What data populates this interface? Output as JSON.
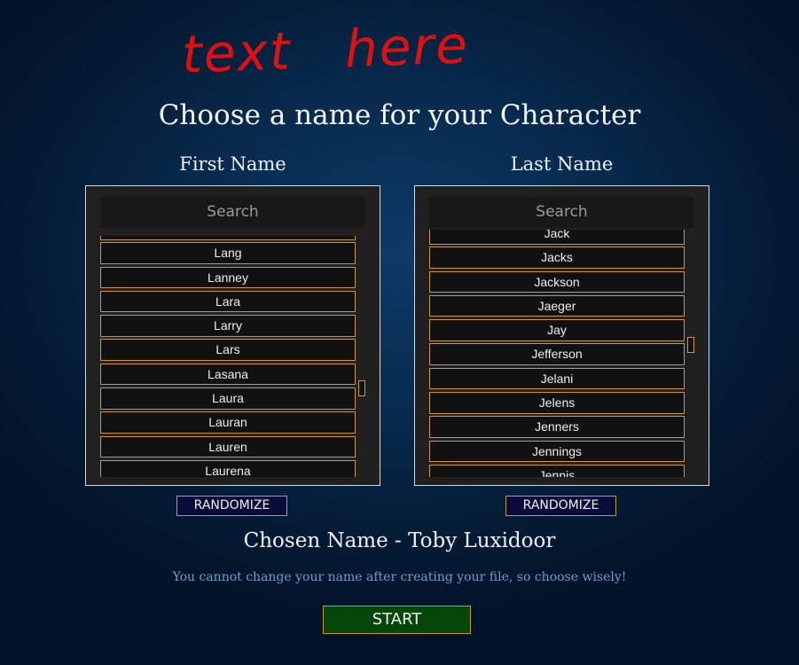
{
  "annotation": "text here",
  "title": "Choose a name for your Character",
  "first": {
    "heading": "First Name",
    "search_placeholder": "Search",
    "items": [
      "",
      "Lang",
      "Lanney",
      "Lara",
      "Larry",
      "Lars",
      "Lasana",
      "Laura",
      "Lauran",
      "Lauren",
      "Laurena"
    ],
    "randomize": "RANDOMIZE"
  },
  "last": {
    "heading": "Last Name",
    "search_placeholder": "Search",
    "items": [
      "Jack",
      "Jacks",
      "Jackson",
      "Jaeger",
      "Jay",
      "Jefferson",
      "Jelani",
      "Jelens",
      "Jenners",
      "Jennings",
      "Jennis"
    ],
    "randomize": "RANDOMIZE"
  },
  "chosen_name": "Chosen Name - Toby Luxidoor",
  "warning": "You cannot change your name after creating your file, so choose wisely!",
  "start": "START",
  "colors": {
    "accent_border": "#c8973e",
    "start_bg": "#03470b",
    "randomize_bg": "#0b0b3a",
    "annotation": "#e01010"
  }
}
